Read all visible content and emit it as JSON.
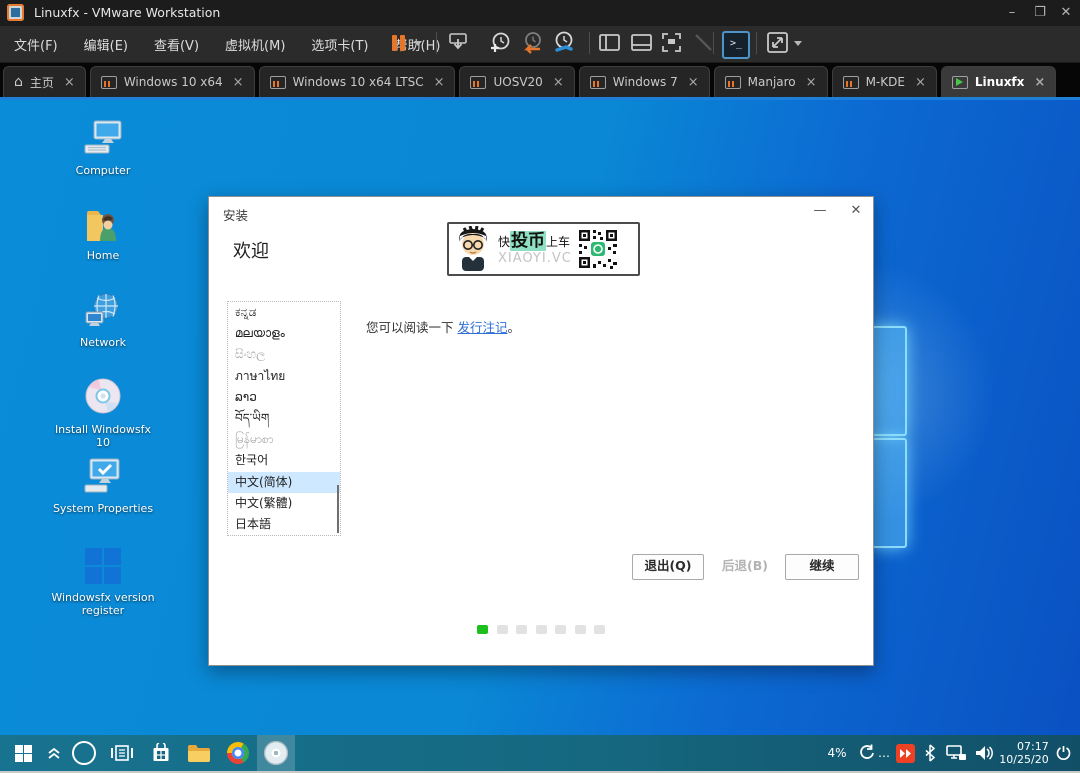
{
  "window": {
    "title": "Linuxfx - VMware Workstation",
    "controls": {
      "minimize": "–",
      "maximize": "❐",
      "close": "✕"
    }
  },
  "menubar": {
    "items": [
      "文件(F)",
      "编辑(E)",
      "查看(V)",
      "虚拟机(M)",
      "选项卡(T)",
      "帮助(H)"
    ]
  },
  "toolbar": {
    "icons": [
      "pause",
      "send-to-device",
      "take-snapshot",
      "revert-snapshot",
      "manage-snapshots",
      "show-library",
      "show-thumbnail-bar",
      "fullscreen-mode",
      "unity-disabled",
      "console-view",
      "fit-guest"
    ]
  },
  "tab_close_glyph": "×",
  "tabs": [
    {
      "label": "主页",
      "type": "home",
      "active": false
    },
    {
      "label": "Windows 10 x64",
      "type": "vm-paused",
      "active": false
    },
    {
      "label": "Windows 10 x64 LTSC",
      "type": "vm-paused",
      "active": false
    },
    {
      "label": "UOSV20",
      "type": "vm-paused",
      "active": false
    },
    {
      "label": "Windows 7",
      "type": "vm-paused",
      "active": false
    },
    {
      "label": "Manjaro",
      "type": "vm-paused",
      "active": false
    },
    {
      "label": "M-KDE",
      "type": "vm-paused",
      "active": false
    },
    {
      "label": "Linuxfx",
      "type": "vm-running",
      "active": true
    }
  ],
  "desktop": {
    "icons": [
      {
        "label": "Computer",
        "icon": "computer"
      },
      {
        "label": "Home",
        "icon": "home-folder"
      },
      {
        "label": "Network",
        "icon": "network"
      },
      {
        "label": "Install Windowsfx 10",
        "icon": "cd"
      },
      {
        "label": "System Properties",
        "icon": "system-properties"
      },
      {
        "label": "Windowsfx version register",
        "icon": "windows-logo"
      }
    ]
  },
  "installer": {
    "title": "安装",
    "heading": "欢迎",
    "controls": {
      "minimize": "—",
      "close": "✕"
    },
    "banner": {
      "prefix": "快",
      "highlight": "投币",
      "suffix": "上车",
      "site": "XIAOYI.VC"
    },
    "languages": [
      {
        "label": "ಕನ್ನಡ",
        "state": "normal"
      },
      {
        "label": "മലയാളം",
        "state": "normal"
      },
      {
        "label": "සිංහල",
        "state": "disabled"
      },
      {
        "label": "ภาษาไทย",
        "state": "normal"
      },
      {
        "label": "ລາວ",
        "state": "normal"
      },
      {
        "label": "བོད་ཡིག",
        "state": "normal"
      },
      {
        "label": "မြန်မာစာ",
        "state": "disabled"
      },
      {
        "label": "한국어",
        "state": "normal"
      },
      {
        "label": "中文(简体)",
        "state": "selected"
      },
      {
        "label": "中文(繁體)",
        "state": "normal"
      },
      {
        "label": "日本語",
        "state": "normal"
      }
    ],
    "note": {
      "before": "您可以阅读一下 ",
      "link": "发行注记",
      "after": "。"
    },
    "buttons": {
      "quit": "退出(Q)",
      "back": "后退(B)",
      "next": "继续"
    },
    "progress": {
      "total": 7,
      "current_index": 0,
      "active_color": "#1dbf1d",
      "inactive_color": "#e2e2e2"
    }
  },
  "taskbar": {
    "battery": "4%",
    "ellipsis": "…",
    "clock": {
      "time": "07:17",
      "date": "10/25/20"
    }
  },
  "colors": {
    "selection": "#cde8ff",
    "link": "#2f6fd6",
    "desktop_left": "#0a8cd8",
    "desktop_right": "#0a51c3",
    "taskbar": "#156880",
    "accent_orange": "#e87628",
    "banner_highlight": "#8fe0c2"
  }
}
